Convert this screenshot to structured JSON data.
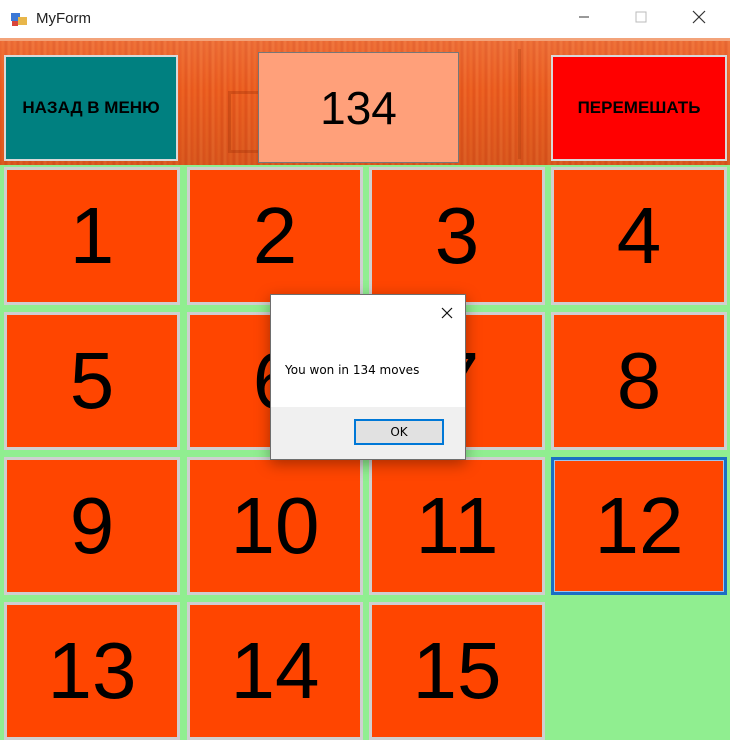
{
  "window": {
    "title": "MyForm",
    "controls": {
      "minimize": "minimize-icon",
      "maximize": "maximize-icon",
      "close": "close-icon"
    }
  },
  "header": {
    "back_button": "НАЗАД В МЕНЮ",
    "move_counter": "134",
    "shuffle_button": "ПЕРЕМЕШАТЬ",
    "colors": {
      "back": "#008080",
      "counter": "#ffa07a",
      "shuffle": "#ff0000"
    }
  },
  "board": {
    "tile_color": "#ff4500",
    "background_color": "#90ee90",
    "tiles": [
      "1",
      "2",
      "3",
      "4",
      "5",
      "6",
      "7",
      "8",
      "9",
      "10",
      "11",
      "12",
      "13",
      "14",
      "15",
      ""
    ],
    "focused_tile": "12"
  },
  "dialog": {
    "message": "You won in 134 moves",
    "ok_label": "OK",
    "close_icon": "close-icon"
  }
}
